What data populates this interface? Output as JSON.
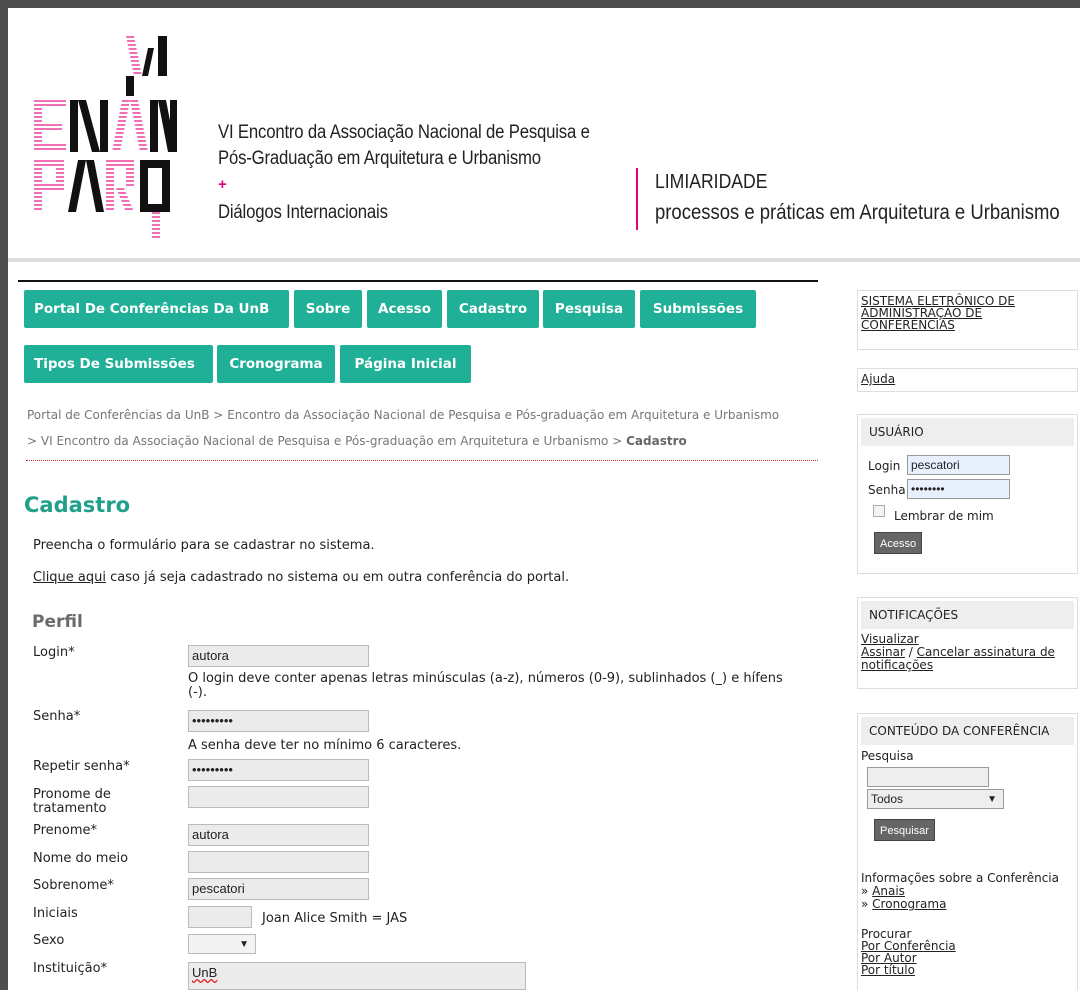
{
  "header": {
    "logo_text": [
      "VI",
      "ENAN",
      "PARQ"
    ],
    "line1": "VI Encontro da Associação Nacional de Pesquisa e",
    "line2": "Pós-Graduação em Arquitetura e Urbanismo",
    "plus": "+",
    "line3": "Diálogos Internacionais",
    "limiaridade": "LIMIARIDADE",
    "limiaridade_sub": "processos e práticas em Arquitetura e Urbanismo",
    "accent_color": "#e6007e"
  },
  "nav": {
    "items": [
      "Portal De Conferências Da UnB",
      "Sobre",
      "Acesso",
      "Cadastro",
      "Pesquisa",
      "Submissões",
      "Tipos De Submissões",
      "Cronograma",
      "Página Inicial"
    ],
    "color": "#20b097"
  },
  "breadcrumb": {
    "c1": "Portal de Conferências da UnB",
    "sep": ">",
    "c2": "Encontro da Associação Nacional de Pesquisa e Pós-graduação em Arquitetura e Urbanismo",
    "c3": "VI Encontro da Associação Nacional de Pesquisa e Pós-graduação em Arquitetura e Urbanismo",
    "current": "Cadastro"
  },
  "page": {
    "title": "Cadastro",
    "intro": "Preencha o formulário para se cadastrar no sistema.",
    "login_link": "Clique aqui",
    "login_text": " caso já seja cadastrado no sistema ou em outra conferência do portal.",
    "section": "Perfil"
  },
  "form": {
    "login_label": "Login*",
    "login_value": "autora",
    "login_help": "O login deve conter apenas letras minúsculas (a-z), números (0-9), sublinhados (_) e hífens (-).",
    "senha_label": "Senha*",
    "senha_value": "•••••••••",
    "senha_help": "A senha deve ter no mínimo 6 caracteres.",
    "repetir_label": "Repetir senha*",
    "repetir_value": "•••••••••",
    "pronome_label": "Pronome de tratamento",
    "pronome_value": "",
    "prenome_label": "Prenome*",
    "prenome_value": "autora",
    "meio_label": "Nome do meio",
    "meio_value": "",
    "sobrenome_label": "Sobrenome*",
    "sobrenome_value": "pescatori",
    "iniciais_label": "Iniciais",
    "iniciais_value": "",
    "iniciais_help": "Joan Alice Smith = JAS",
    "sexo_label": "Sexo",
    "sexo_value": "",
    "instituicao_label": "Instituição*",
    "instituicao_value": "UnB"
  },
  "sidebar": {
    "sistema": "SISTEMA ELETRÔNICO DE ADMINISTRAÇÃO DE CONFERÊNCIAS",
    "ajuda": "Ajuda",
    "usuario_title": "USUÁRIO",
    "login_label": "Login",
    "login_value": "pescatori",
    "senha_label": "Senha",
    "senha_value": "••••••••",
    "lembrar": "Lembrar de mim",
    "acesso_button": "Acesso",
    "notificacoes_title": "NOTIFICAÇÕES",
    "visualizar": "Visualizar",
    "assinar": "Assinar",
    "slash": " / ",
    "cancelar": "Cancelar assinatura de notificações",
    "conteudo_title": "CONTEÚDO DA CONFERÊNCIA",
    "pesquisa_label": "Pesquisa",
    "pesquisa_value": "",
    "select_value": "Todos",
    "pesquisar_button": "Pesquisar",
    "info_title": "Informações sobre a Conferência",
    "bullet": "»",
    "anais": "Anais",
    "cronograma": "Cronograma",
    "procurar": "Procurar",
    "por_conferencia": "Por Conferência",
    "por_autor": "Por Autor",
    "por_titulo": "Por título"
  }
}
